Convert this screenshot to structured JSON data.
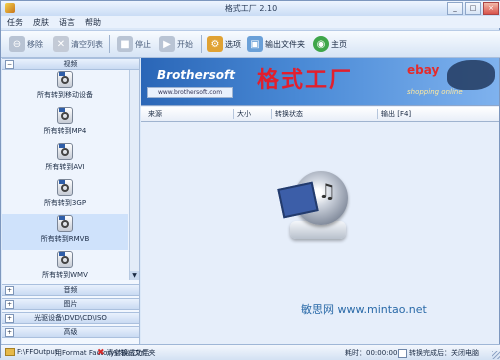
{
  "window": {
    "title": "格式工厂 2.10",
    "minimize_label": "_",
    "maximize_label": "□",
    "close_label": "×"
  },
  "menu": [
    {
      "label": "任务"
    },
    {
      "label": "皮肤"
    },
    {
      "label": "语言"
    },
    {
      "label": "帮助"
    }
  ],
  "toolbar": [
    {
      "label": "移除",
      "icon": "remove-icon",
      "enabled": false
    },
    {
      "label": "清空列表",
      "icon": "clear-list-icon",
      "enabled": false
    },
    {
      "label": "停止",
      "icon": "stop-icon",
      "enabled": false
    },
    {
      "label": "开始",
      "icon": "start-icon",
      "enabled": false
    },
    {
      "label": "选项",
      "icon": "options-icon",
      "enabled": true
    },
    {
      "label": "输出文件夹",
      "icon": "output-folder-icon",
      "enabled": true
    },
    {
      "label": "主页",
      "icon": "home-icon",
      "enabled": true
    }
  ],
  "sidebar": {
    "video_header": "视频",
    "video_header_icon": "collapse-icon",
    "video_items": [
      {
        "label": "所有转到移动设备"
      },
      {
        "label": "所有转到MP4"
      },
      {
        "label": "所有转到AVI"
      },
      {
        "label": "所有转到3GP"
      },
      {
        "label": "所有转到RMVB"
      },
      {
        "label": "所有转到WMV"
      }
    ],
    "collapsed_sections": [
      {
        "label": "音频"
      },
      {
        "label": "图片"
      },
      {
        "label": "光驱设备\\DVD\\CD\\ISO"
      },
      {
        "label": "高级"
      }
    ]
  },
  "banner": {
    "brothersoft": "Brothersoft",
    "banner_url": "www.brothersoft.com",
    "cn_title": "格式工厂",
    "ebay": "ebay",
    "shopping": "shopping online"
  },
  "file_table": {
    "columns": [
      "来源",
      "大小",
      "转换状态",
      "输出 [F4]"
    ]
  },
  "watermark": "敏思网 www.mintao.net",
  "statusbar": {
    "output_path": "F:\\FFOutput",
    "open_output_label": "用Format Factory转换成功后",
    "clear_list_label": "清空输出文件夹",
    "elapsed": "耗时：00:00:00",
    "shutdown_label": "转换完成后：关闭电脑"
  },
  "colors": {
    "accent": "#2a66b7",
    "title_red": "#e21f2d",
    "panel": "#e6eefa"
  }
}
